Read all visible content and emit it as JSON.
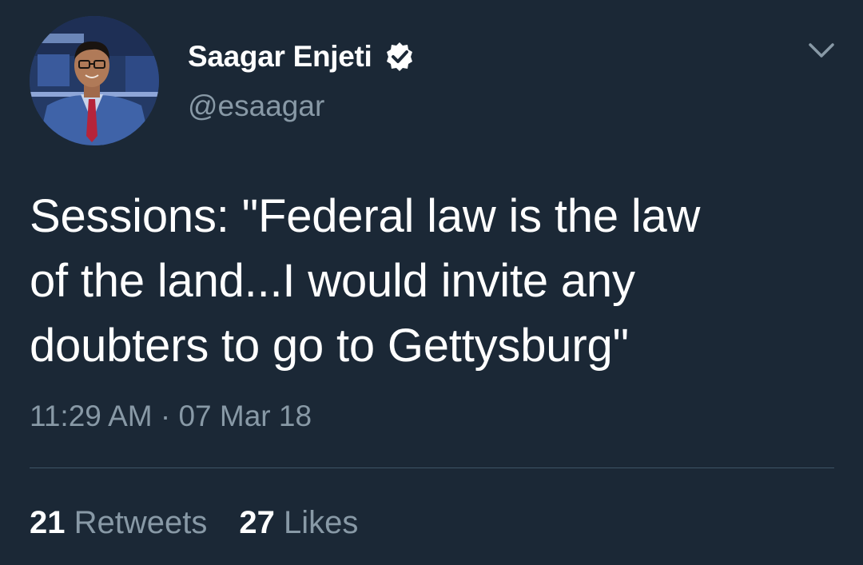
{
  "tweet": {
    "author": {
      "display_name": "Saagar Enjeti",
      "handle": "@esaagar",
      "verified": true
    },
    "text_lines": [
      "Sessions: \"Federal law is the law",
      "of the land...I would invite any",
      "doubters to go to Gettysburg\""
    ],
    "timestamp": "11:29 AM · 07 Mar 18",
    "stats": {
      "retweets_count": "21",
      "retweets_label": "Retweets",
      "likes_count": "27",
      "likes_label": "Likes"
    }
  },
  "icons": {
    "verified": "verified-badge-icon",
    "menu": "chevron-down-icon"
  },
  "colors": {
    "background": "#1b2836",
    "primary_text": "#ffffff",
    "secondary_text": "#8899a6",
    "divider": "#3d5466"
  }
}
